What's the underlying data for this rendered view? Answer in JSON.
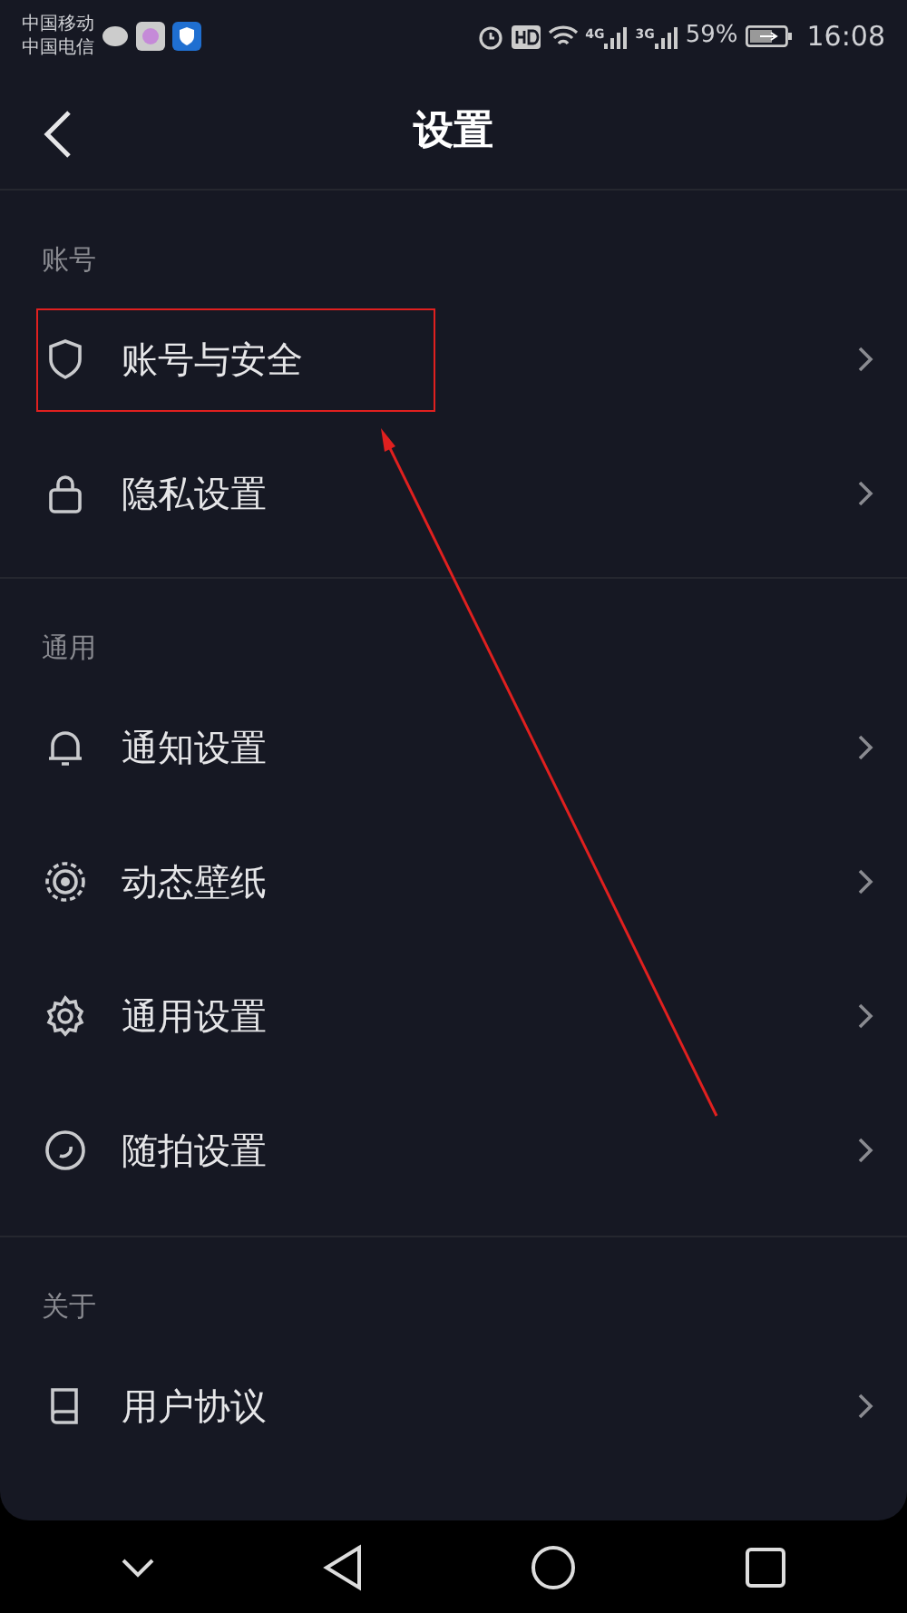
{
  "status_bar": {
    "carriers": [
      "中国移动",
      "中国电信"
    ],
    "network_1": "4G",
    "network_2": "3G",
    "battery": "59%",
    "time": "16:08"
  },
  "header": {
    "title": "设置"
  },
  "sections": [
    {
      "title": "账号",
      "items": [
        {
          "label": "账号与安全",
          "highlighted": true
        },
        {
          "label": "隐私设置",
          "highlighted": false
        }
      ]
    },
    {
      "title": "通用",
      "items": [
        {
          "label": "通知设置",
          "highlighted": false
        },
        {
          "label": "动态壁纸",
          "highlighted": false
        },
        {
          "label": "通用设置",
          "highlighted": false
        },
        {
          "label": "随拍设置",
          "highlighted": false
        }
      ]
    },
    {
      "title": "关于",
      "items": [
        {
          "label": "用户协议",
          "highlighted": false
        }
      ]
    }
  ]
}
